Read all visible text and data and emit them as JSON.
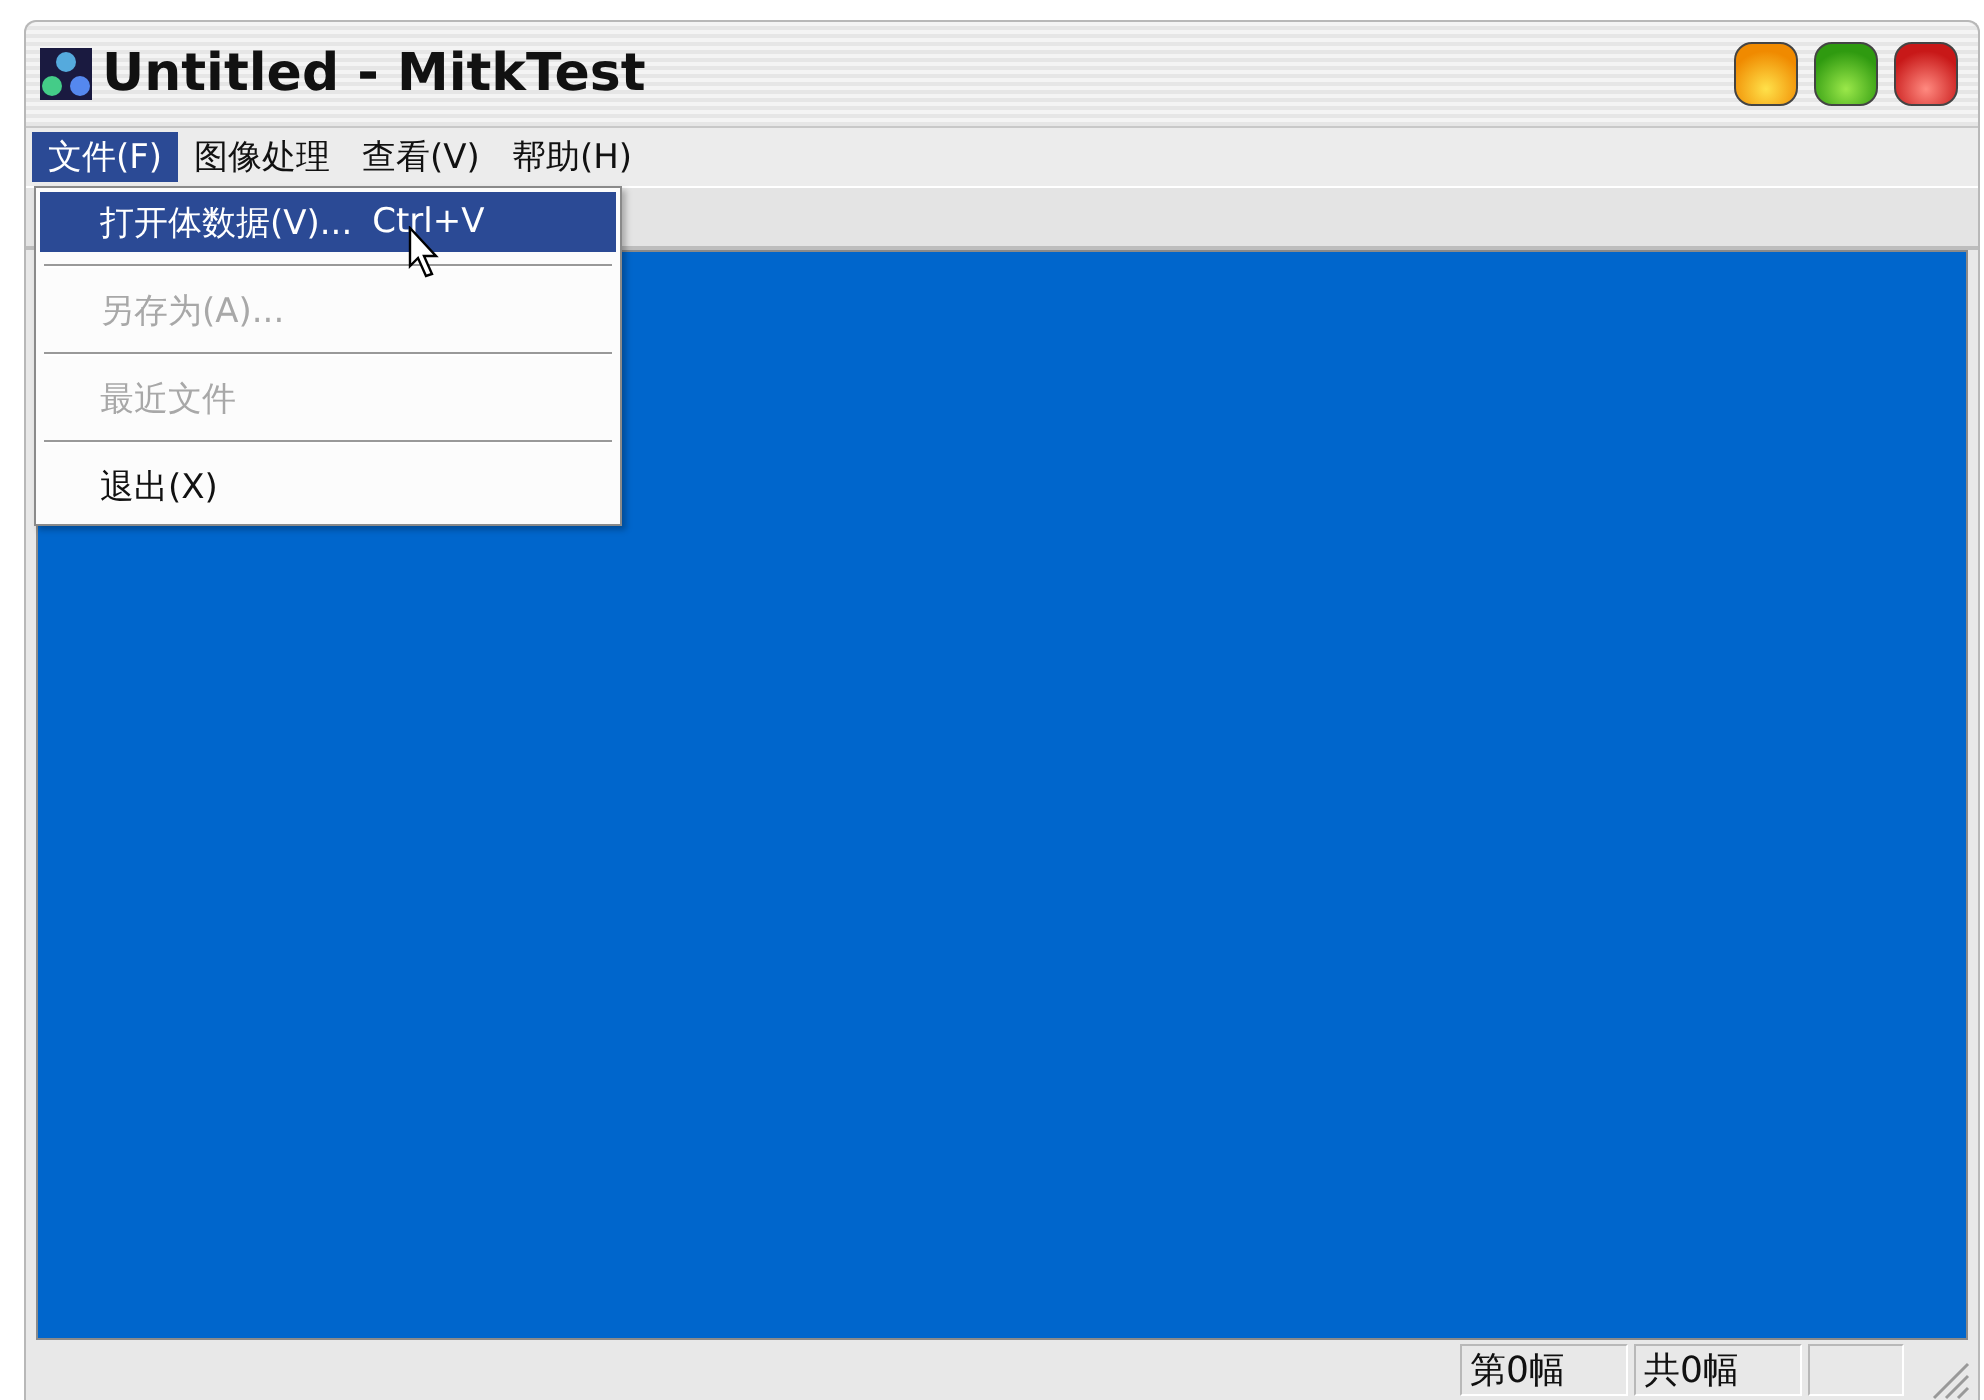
{
  "window": {
    "title": "Untitled - MitkTest"
  },
  "menu_bar": [
    {
      "label": "文件(F)",
      "selected": true
    },
    {
      "label": "图像处理",
      "selected": false
    },
    {
      "label": "查看(V)",
      "selected": false
    },
    {
      "label": "帮助(H)",
      "selected": false
    }
  ],
  "file_menu": [
    {
      "kind": "command",
      "label": "打开体数据(V)...",
      "shortcut": "Ctrl+V",
      "selected": true,
      "disabled": false
    },
    {
      "kind": "separator"
    },
    {
      "kind": "command",
      "label": "另存为(A)...",
      "selected": false,
      "disabled": true
    },
    {
      "kind": "separator"
    },
    {
      "kind": "command",
      "label": "最近文件",
      "selected": false,
      "disabled": true
    },
    {
      "kind": "separator"
    },
    {
      "kind": "command",
      "label": "退出(X)",
      "selected": false,
      "disabled": false
    }
  ],
  "status_bar": [
    "第0幅",
    "共0幅"
  ]
}
